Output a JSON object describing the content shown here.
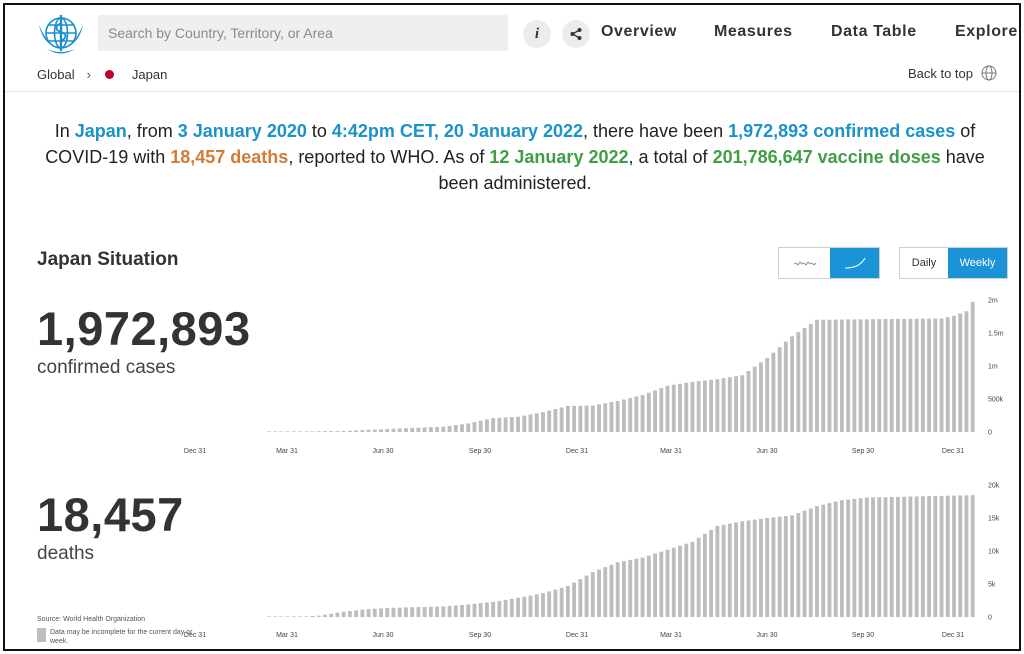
{
  "header": {
    "search_placeholder": "Search by Country, Territory, or Area",
    "nav": [
      "Overview",
      "Measures",
      "Data Table",
      "Explore"
    ]
  },
  "breadcrumb": {
    "root": "Global",
    "country": "Japan"
  },
  "back_to_top": "Back to top",
  "summary": {
    "s1": "In ",
    "country": "Japan",
    "s2": ", from ",
    "start_date": "3 January 2020",
    "s3": " to ",
    "end_date": "4:42pm CET, 20 January 2022",
    "s4": ", there have been ",
    "cases": "1,972,893 confirmed cases",
    "s5": " of COVID-19 with ",
    "deaths": "18,457 deaths",
    "s6": ", reported to WHO. As of ",
    "vaccine_date": "12 January 2022",
    "s7": ", a total of ",
    "vaccine_doses": "201,786,647 vaccine doses",
    "s8": " have been administered."
  },
  "situation": {
    "title": "Japan Situation",
    "period_daily": "Daily",
    "period_weekly": "Weekly",
    "active_chart_mode": "cumulative",
    "active_period": "Weekly"
  },
  "cases_panel": {
    "number": "1,972,893",
    "label": "confirmed cases"
  },
  "deaths_panel": {
    "number": "18,457",
    "label": "deaths"
  },
  "source": "Source: World Health Organization",
  "legend_note": "Data may be incomplete for the current day or week.",
  "colors": {
    "accent": "#1a93d7",
    "bar": "#bdbdbd",
    "japan_flag_dot": "#bc002d"
  },
  "chart_data": [
    {
      "type": "bar",
      "title": "",
      "x_tick_labels": [
        "Dec 31",
        "Mar 31",
        "Jun 30",
        "Sep 30",
        "Dec 31",
        "Mar 31",
        "Jun 30",
        "Sep 30",
        "Dec 31"
      ],
      "y_tick_labels": [
        "0",
        "500k",
        "1m",
        "1.5m",
        "2m"
      ],
      "ylim": [
        0,
        2000000
      ],
      "anchors": [
        [
          0,
          0
        ],
        [
          4,
          4000
        ],
        [
          8,
          12000
        ],
        [
          12,
          15000
        ],
        [
          20,
          50000
        ],
        [
          28,
          80000
        ],
        [
          32,
          130000
        ],
        [
          36,
          210000
        ],
        [
          40,
          230000
        ],
        [
          44,
          300000
        ],
        [
          48,
          395000
        ],
        [
          52,
          400000
        ],
        [
          56,
          470000
        ],
        [
          60,
          560000
        ],
        [
          64,
          700000
        ],
        [
          68,
          760000
        ],
        [
          72,
          800000
        ],
        [
          76,
          860000
        ],
        [
          80,
          1120000
        ],
        [
          84,
          1450000
        ],
        [
          88,
          1700000
        ],
        [
          108,
          1720000
        ],
        [
          110,
          1760000
        ],
        [
          112,
          1830000
        ],
        [
          113,
          1972893
        ]
      ]
    },
    {
      "type": "bar",
      "title": "",
      "x_tick_labels": [
        "Dec 31",
        "Mar 31",
        "Jun 30",
        "Sep 30",
        "Dec 31",
        "Mar 31",
        "Jun 30",
        "Sep 30",
        "Dec 31"
      ],
      "y_tick_labels": [
        "0",
        "5k",
        "10k",
        "15k",
        "20k"
      ],
      "ylim": [
        0,
        20000
      ],
      "anchors": [
        [
          0,
          0
        ],
        [
          4,
          0
        ],
        [
          8,
          200
        ],
        [
          12,
          800
        ],
        [
          16,
          1200
        ],
        [
          20,
          1400
        ],
        [
          28,
          1600
        ],
        [
          32,
          1900
        ],
        [
          36,
          2300
        ],
        [
          40,
          2900
        ],
        [
          44,
          3600
        ],
        [
          48,
          4700
        ],
        [
          52,
          6800
        ],
        [
          56,
          8300
        ],
        [
          60,
          9000
        ],
        [
          64,
          10200
        ],
        [
          68,
          11400
        ],
        [
          72,
          13800
        ],
        [
          76,
          14500
        ],
        [
          80,
          15000
        ],
        [
          84,
          15400
        ],
        [
          88,
          16800
        ],
        [
          92,
          17700
        ],
        [
          96,
          18100
        ],
        [
          113,
          18457
        ]
      ]
    }
  ]
}
